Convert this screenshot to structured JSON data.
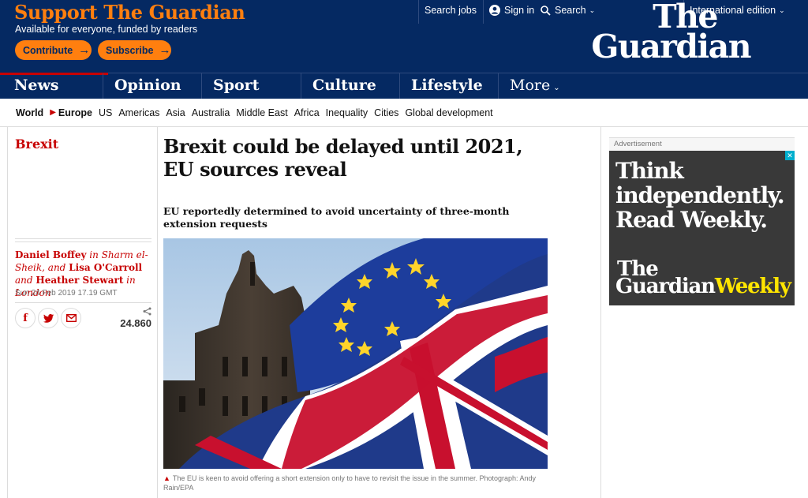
{
  "header": {
    "support_title": "Support The Guardian",
    "support_subtitle": "Available for everyone, funded by readers",
    "contribute_label": "Contribute",
    "subscribe_label": "Subscribe",
    "arrow": "→",
    "search_jobs": "Search jobs",
    "sign_in": "Sign in",
    "search": "Search",
    "edition": "International edition",
    "chevron": "⌄",
    "logo_line1": "The",
    "logo_line2": "Guardian"
  },
  "pillars": [
    {
      "label": "News",
      "active": true
    },
    {
      "label": "Opinion",
      "active": false
    },
    {
      "label": "Sport",
      "active": false
    },
    {
      "label": "Culture",
      "active": false
    },
    {
      "label": "Lifestyle",
      "active": false
    },
    {
      "label": "More",
      "active": false
    }
  ],
  "subnav": {
    "items": [
      "World",
      "Europe",
      "US",
      "Americas",
      "Asia",
      "Australia",
      "Middle East",
      "Africa",
      "Inequality",
      "Cities",
      "Global development"
    ],
    "current": "Europe"
  },
  "article": {
    "series": "Brexit",
    "headline": "Brexit could be delayed until 2021, EU sources reveal",
    "standfirst": "EU reportedly determined to avoid uncertainty of three-month extension requests",
    "byline": {
      "author1": "Daniel Boffey",
      "loc1": " in Sharm el-Sheik, and ",
      "author2": "Lisa O'Carroll",
      "loc2": " and ",
      "author3": "Heather Stewart",
      "loc3": " in London"
    },
    "dateline": "Sun 24 Feb 2019 17.19 GMT",
    "share_count": "24.860",
    "share_icons": [
      "facebook-icon",
      "twitter-icon",
      "email-icon"
    ],
    "caption_marker": "▲",
    "caption": "The EU is keen to avoid offering a short extension only to have to revisit the issue in the summer. Photograph: Andy Rain/EPA"
  },
  "advert": {
    "label": "Advertisement",
    "headline_lines": [
      "Think",
      "independently.",
      "Read Weekly."
    ],
    "logo_the": "The",
    "logo_guardian": "Guardian",
    "logo_weekly": "Weekly"
  },
  "colors": {
    "brand_blue": "#052962",
    "support_orange": "#ff7f0f",
    "news_red": "#c70000",
    "weekly_yellow": "#ffe500"
  }
}
